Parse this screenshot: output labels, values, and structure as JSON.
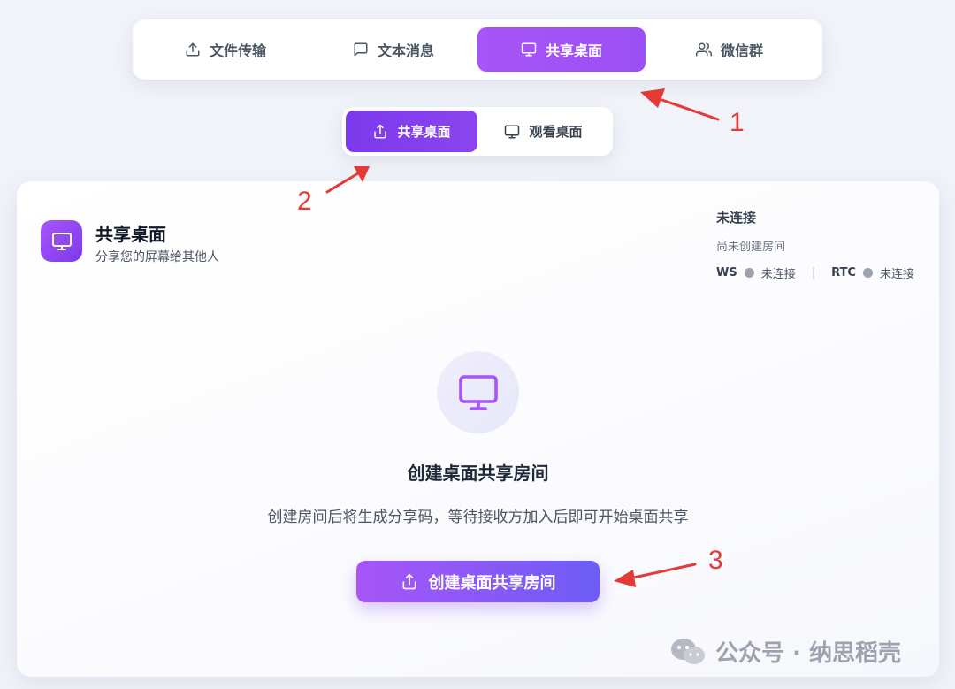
{
  "top_tabs": [
    {
      "label": "文件传输",
      "icon": "upload-icon"
    },
    {
      "label": "文本消息",
      "icon": "message-icon"
    },
    {
      "label": "共享桌面",
      "icon": "monitor-icon",
      "active": true
    },
    {
      "label": "微信群",
      "icon": "users-icon"
    }
  ],
  "sub_tabs": [
    {
      "label": "共享桌面",
      "icon": "upload-icon",
      "active": true
    },
    {
      "label": "观看桌面",
      "icon": "monitor-icon"
    }
  ],
  "card": {
    "title": "共享桌面",
    "subtitle": "分享您的屏幕给其他人",
    "status": {
      "title": "未连接",
      "sub": "尚未创建房间",
      "ws_label": "WS",
      "ws_value": "未连接",
      "separator": "|",
      "rtc_label": "RTC",
      "rtc_value": "未连接"
    },
    "hero_title": "创建桌面共享房间",
    "hero_desc": "创建房间后将生成分享码，等待接收方加入后即可开始桌面共享",
    "create_button": "创建桌面共享房间"
  },
  "annotations": [
    "1",
    "2",
    "3"
  ],
  "watermark": "公众号 · 纳思稻壳",
  "colors": {
    "accent": "#a855f7",
    "accent_dark": "#7c3aed",
    "annotation": "#e53935",
    "status_dot": "#9ca3af"
  }
}
